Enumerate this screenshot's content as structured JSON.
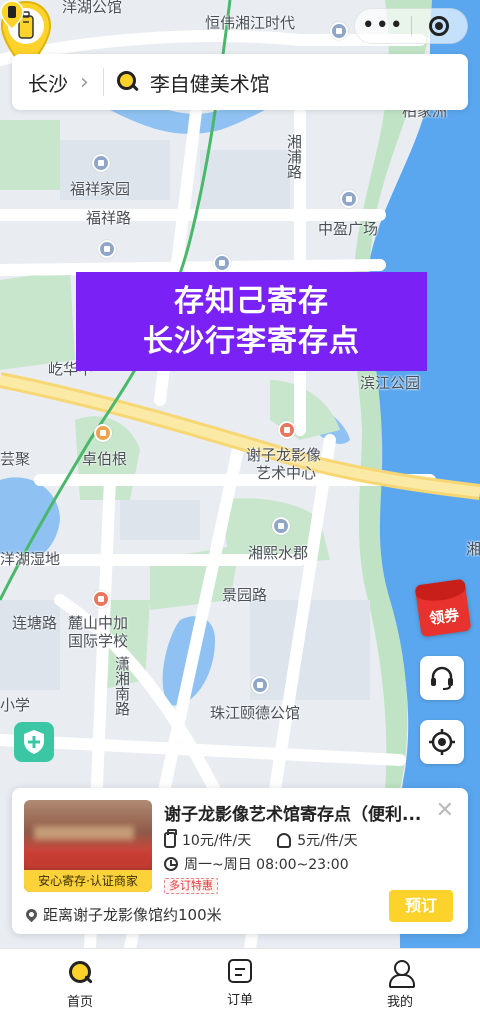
{
  "top": {
    "capsule_dots": "•••"
  },
  "search": {
    "city": "长沙",
    "query": "李自健美术馆"
  },
  "map": {
    "labels": [
      "洋湖公馆",
      "恒伟湘江时代",
      "柏家洲",
      "福祥家园",
      "福祥路",
      "湘浦路",
      "中盈广场",
      "屹华中",
      "滨江公园",
      "卓伯根",
      "芸聚",
      "谢子龙影像",
      "艺术中心",
      "湘熙水郡",
      "洋湖湿地",
      "麓山中加",
      "国际学校",
      "景园路",
      "连塘路",
      "潇湘南路",
      "珠江颐德公馆",
      "小学",
      "湘"
    ]
  },
  "banner": {
    "line1": "存知己寄存",
    "line2": "长沙行李寄存点"
  },
  "coupon": {
    "label": "领券"
  },
  "card": {
    "title": "谢子龙影像艺术馆寄存点（便利...",
    "badge": "安心寄存·认证商家",
    "price_large": "10元/件/天",
    "price_small": "5元/件/天",
    "hours": "周一~周日 08:00~23:00",
    "tag": "多订特惠",
    "distance": "距离谢子龙影像馆约100米",
    "book_label": "预订"
  },
  "tabs": [
    {
      "label": "首页",
      "icon": "search-home-icon"
    },
    {
      "label": "订单",
      "icon": "order-icon"
    },
    {
      "label": "我的",
      "icon": "user-icon"
    }
  ],
  "colors": {
    "brand_yellow": "#fdd22a",
    "banner_purple": "#7a21f5",
    "river": "#5aa7ef",
    "park": "#bfe3c4",
    "coupon_red": "#e8322d",
    "shield_green": "#3cc7a4"
  }
}
